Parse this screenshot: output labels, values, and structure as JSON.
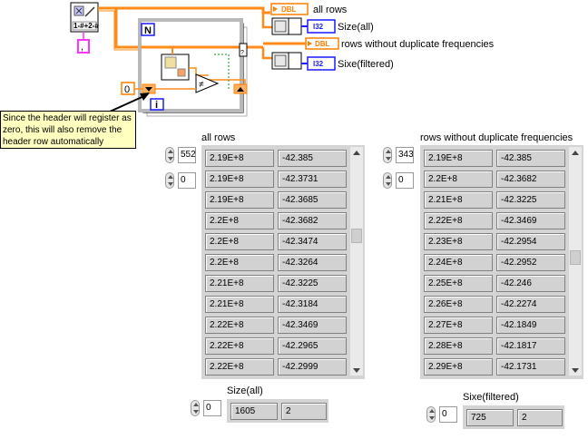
{
  "block_diagram": {
    "indicators": {
      "all_rows_label": "all rows",
      "size_all_label": "Size(all)",
      "filtered_label": "rows without duplicate frequencies",
      "size_filtered_label": "Sixe(filtered)"
    },
    "badges": {
      "dbl": "DBL",
      "i32": "I32"
    },
    "loop": {
      "n": "N",
      "i": "i",
      "const_zero": "0",
      "delimiter": ",",
      "header_icon": "1-#+2-#"
    },
    "comment": "Since the header will register as zero, this will also remove the header row automatically"
  },
  "panel_all": {
    "label": "all rows",
    "index0": "552",
    "index1": "0",
    "col1": [
      "2.19E+8",
      "2.19E+8",
      "2.19E+8",
      "2.2E+8",
      "2.2E+8",
      "2.2E+8",
      "2.21E+8",
      "2.21E+8",
      "2.22E+8",
      "2.22E+8",
      "2.22E+8"
    ],
    "col2": [
      "-42.385",
      "-42.3731",
      "-42.3685",
      "-42.3682",
      "-42.3474",
      "-42.3264",
      "-42.3225",
      "-42.3184",
      "-42.3469",
      "-42.2965",
      "-42.2999"
    ]
  },
  "panel_filtered": {
    "label": "rows without duplicate frequencies",
    "index0": "343",
    "index1": "0",
    "col1": [
      "2.19E+8",
      "2.2E+8",
      "2.21E+8",
      "2.22E+8",
      "2.23E+8",
      "2.24E+8",
      "2.25E+8",
      "2.26E+8",
      "2.27E+8",
      "2.28E+8",
      "2.29E+8"
    ],
    "col2": [
      "-42.385",
      "-42.3682",
      "-42.3225",
      "-42.3469",
      "-42.2954",
      "-42.2952",
      "-42.246",
      "-42.2274",
      "-42.1849",
      "-42.1817",
      "-42.1731"
    ]
  },
  "size_all": {
    "label": "Size(all)",
    "index": "0",
    "values": [
      "1605",
      "2"
    ]
  },
  "size_filtered": {
    "label": "Sixe(filtered)",
    "index": "0",
    "values": [
      "725",
      "2"
    ]
  },
  "colors": {
    "dbl_orange": "#ff7f00",
    "i32_blue": "#1a1aff",
    "wire_pink": "#ff33ff",
    "wire_tan": "#c8a050"
  }
}
